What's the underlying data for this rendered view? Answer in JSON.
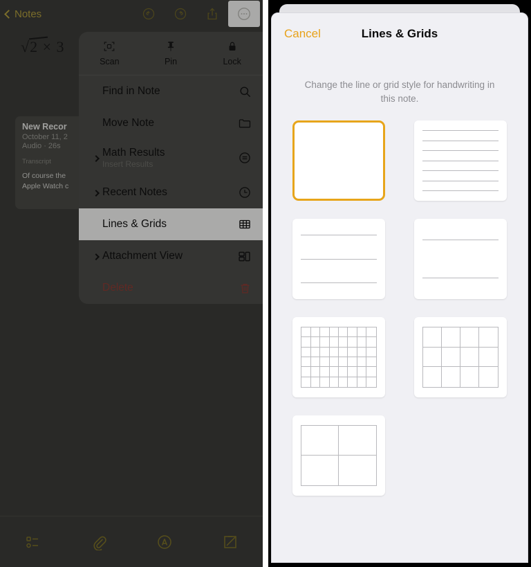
{
  "left": {
    "nav": {
      "back_label": "Notes",
      "icons": [
        {
          "name": "undo-icon",
          "glyph": "undo"
        },
        {
          "name": "redo-icon",
          "glyph": "redo"
        },
        {
          "name": "share-icon",
          "glyph": "share"
        },
        {
          "name": "more-icon",
          "glyph": "ellipsis-circle"
        }
      ]
    },
    "handwriting": {
      "expr": "2",
      "suffix": "× 3",
      "radical": "√"
    },
    "note_card": {
      "title": "New Recor",
      "date": "October 11, 2",
      "meta": "Audio · 26s",
      "transcript_label": "Transcript",
      "body_line1": "Of course the",
      "body_line2": "Apple Watch c"
    },
    "context_menu": {
      "top_actions": [
        {
          "label": "Scan",
          "icon": "scan-icon"
        },
        {
          "label": "Pin",
          "icon": "pin-icon"
        },
        {
          "label": "Lock",
          "icon": "lock-icon"
        }
      ],
      "rows": [
        {
          "label": "Find in Note",
          "sub": "",
          "icon": "search-icon",
          "expandable": false,
          "highlight": false,
          "destructive": false
        },
        {
          "label": "Move Note",
          "sub": "",
          "icon": "folder-icon",
          "expandable": false,
          "highlight": false,
          "destructive": false
        },
        {
          "label": "Math Results",
          "sub": "Insert Results",
          "icon": "math-results-icon",
          "expandable": true,
          "highlight": false,
          "destructive": false
        },
        {
          "label": "Recent Notes",
          "sub": "",
          "icon": "clock-icon",
          "expandable": true,
          "highlight": false,
          "destructive": false
        },
        {
          "label": "Lines & Grids",
          "sub": "",
          "icon": "grid-icon",
          "expandable": false,
          "highlight": true,
          "destructive": false
        },
        {
          "label": "Attachment View",
          "sub": "",
          "icon": "attachment-view-icon",
          "expandable": true,
          "highlight": false,
          "destructive": false
        },
        {
          "label": "Delete",
          "sub": "",
          "icon": "trash-icon",
          "expandable": false,
          "highlight": false,
          "destructive": true
        }
      ]
    },
    "bottom_bar": [
      {
        "name": "checklist-icon"
      },
      {
        "name": "paperclip-icon"
      },
      {
        "name": "markup-icon"
      },
      {
        "name": "compose-icon"
      }
    ]
  },
  "right": {
    "cancel_label": "Cancel",
    "title": "Lines & Grids",
    "description": "Change the line or grid style for handwriting in this note.",
    "accent_color": "#e7a51b",
    "options": [
      {
        "name": "style-none",
        "type": "blank",
        "selected": true
      },
      {
        "name": "style-lines-narrow",
        "type": "lines",
        "lines": 7,
        "selected": false
      },
      {
        "name": "style-lines-medium",
        "type": "lines",
        "lines": 3,
        "selected": false
      },
      {
        "name": "style-lines-wide",
        "type": "lines",
        "lines": 2,
        "selected": false
      },
      {
        "name": "style-grid-small",
        "type": "grid",
        "cols": 8,
        "rows": 6,
        "selected": false
      },
      {
        "name": "style-grid-medium",
        "type": "grid",
        "cols": 4,
        "rows": 3,
        "selected": false
      },
      {
        "name": "style-grid-large",
        "type": "grid",
        "cols": 2,
        "rows": 2,
        "selected": false
      }
    ]
  }
}
